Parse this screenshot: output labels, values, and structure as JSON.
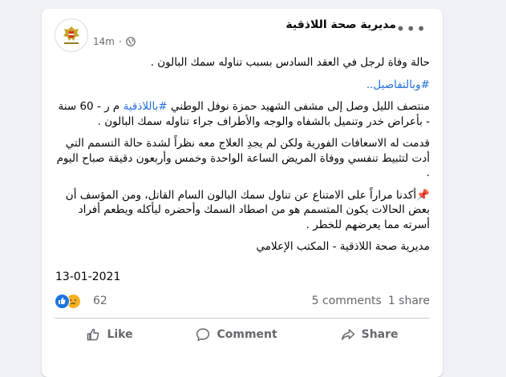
{
  "post": {
    "author": "مديرية صحة اللاذقية",
    "time": "14m",
    "paragraphs": [
      {
        "text": "حالة وفاة لرجل في العقد السادس بسبب تناوله سمك البالون ."
      },
      {
        "hashtag": "#وبالتفاصيل.."
      },
      {
        "before": "منتصف الليل وصل إلى مشفى الشهيد حمزة نوفل الوطني ",
        "hashtag": "#باللاذقية",
        "after": " م ر - 60 سنة - بأعراض خدر وتنميل بالشفاه والوجه والأطراف جراء تناوله سمك البالون ."
      },
      {
        "text": "قدمت له الاسعافات الفورية ولكن لم يجدِ العلاج معه نظراً لشدة حالة التسمم التي أدت لتثبيط تنفسي ووفاة المريض الساعة الواحدة وخمس وأربعون دقيقة صباح اليوم ."
      },
      {
        "text": "📌أكدنا مراراً على الامتناع عن تناول سمك البالون السام القاتل، ومن المؤسف أن بعض الحالات يكون المتسمم هو من اصطاد السمك وأحضره ليأكله ويطعم أفراد أسرته مما يعرضهم للخطر ."
      },
      {
        "text": "مديرية صحة اللاذقية - المكتب الإعلامي"
      }
    ],
    "date": "13-01-2021",
    "reaction_count": "62",
    "comments": "5 comments",
    "shares": "1 share"
  },
  "actions": {
    "like": "Like",
    "comment": "Comment",
    "share": "Share"
  },
  "colors": {
    "link": "#216fdb",
    "like_blue": "#1b74e4",
    "sad_yellow": "#f7b125",
    "muted": "#65676b"
  },
  "icons": [
    "globe-icon",
    "more-options-icon",
    "like-reaction-icon",
    "sad-reaction-icon",
    "thumbs-up-icon",
    "comment-icon",
    "share-icon"
  ]
}
